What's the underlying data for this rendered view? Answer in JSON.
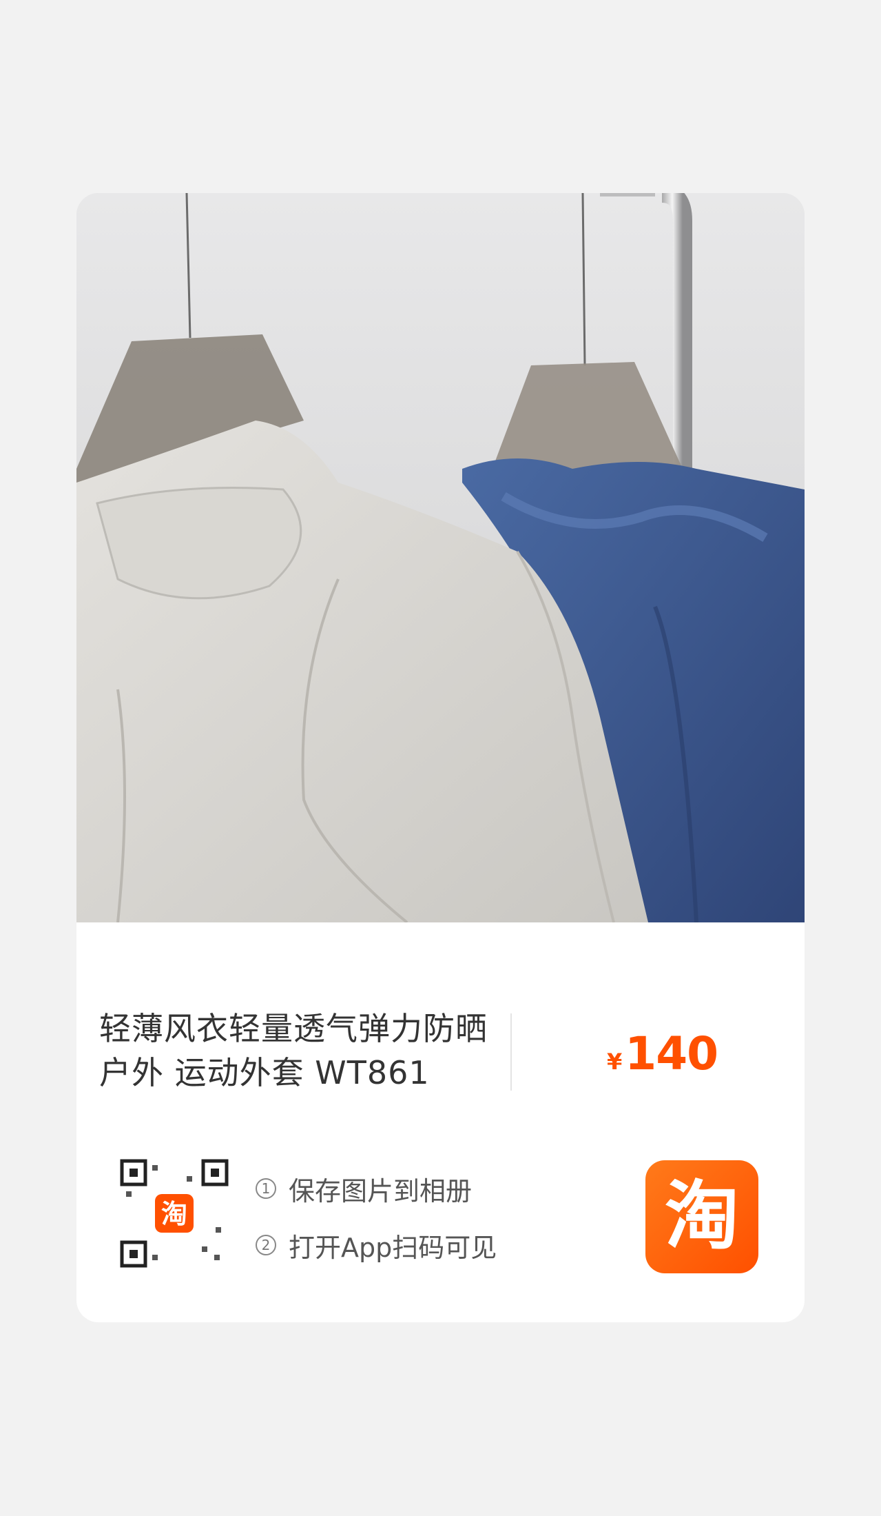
{
  "product": {
    "title": "轻薄风衣轻量透气弹力防晒户外 运动外套 WT861",
    "price_symbol": "¥",
    "price_value": "140"
  },
  "steps": [
    {
      "num": "1",
      "label": "保存图片到相册"
    },
    {
      "num": "2",
      "label": "打开App扫码可见"
    }
  ],
  "badges": {
    "qr_logo_char": "淘",
    "app_logo_char": "淘"
  },
  "colors": {
    "accent": "#ff5000",
    "background": "#f2f2f2",
    "card": "#ffffff",
    "jacket_light": "#d8d6d2",
    "jacket_navy": "#3a5287"
  },
  "icons": [
    "qr-code-icon",
    "taobao-app-icon"
  ]
}
